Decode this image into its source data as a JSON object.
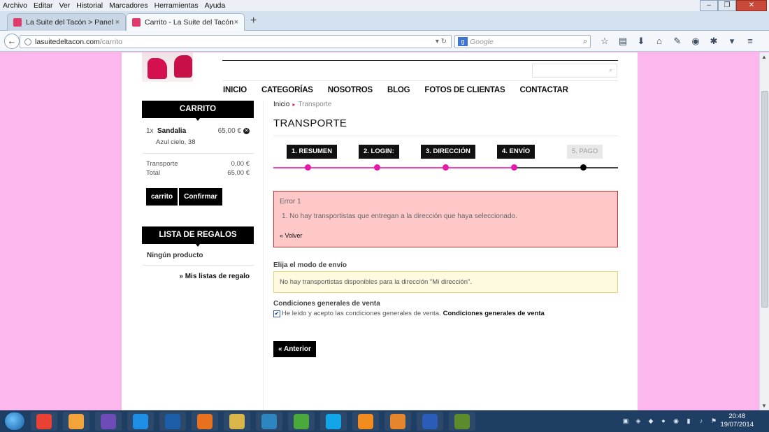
{
  "browser": {
    "menu": [
      "Archivo",
      "Editar",
      "Ver",
      "Historial",
      "Marcadores",
      "Herramientas",
      "Ayuda"
    ],
    "tabs": [
      {
        "label": "La Suite del Tacón > Panel ...",
        "active": false
      },
      {
        "label": "Carrito - La Suite del Tacón",
        "active": true
      }
    ],
    "new_tab": "+",
    "tab_close": "×",
    "url_host": "lasuitedeltacon.com",
    "url_path": "/carrito",
    "search_engine": "Google",
    "search_placeholder": "Google",
    "window_controls": {
      "minimize": "–",
      "restore": "❐",
      "close": "✕"
    }
  },
  "site": {
    "nav": [
      "INICIO",
      "CATEGORÍAS",
      "NOSOTROS",
      "BLOG",
      "FOTOS DE CLIENTAS",
      "CONTACTAR"
    ],
    "cart": {
      "title": "CARRITO",
      "item": {
        "qty": "1x",
        "name": "Sandalia",
        "price": "65,00 €",
        "variant": "Azul cielo, 38"
      },
      "shipping_label": "Transporte",
      "shipping_value": "0,00 €",
      "total_label": "Total",
      "total_value": "65,00 €",
      "btn_cart": "carrito",
      "btn_confirm": "Confirmar"
    },
    "gifts": {
      "title": "LISTA DE REGALOS",
      "empty": "Ningún producto",
      "link": "» Mis listas de regalo"
    },
    "breadcrumb": {
      "home": "Inicio",
      "current": "Transporte"
    },
    "page_title": "TRANSPORTE",
    "steps": [
      "1. RESUMEN",
      "2. LOGIN:",
      "3. DIRECCIÓN",
      "4. ENVÍO",
      "5. PAGO"
    ],
    "error": {
      "title": "Error 1",
      "message": "1.   No hay transportistas que entregan a la dirección que haya seleccionado.",
      "back": "« Volver"
    },
    "shipping_mode_label": "Elija el modo de envío",
    "shipping_warning": "No hay transportistas disponibles para la dirección \"Mi dirección\".",
    "conditions_label": "Condiciones generales de venta",
    "conditions_check_text": "He leído y acepto las condiciones generales de venta.",
    "conditions_link": "Condiciones generales de venta",
    "prev_button": "« Anterior"
  },
  "taskbar": {
    "time": "20:48",
    "date": "19/07/2014",
    "apps": [
      "chrome",
      "paint",
      "eclipse",
      "dropbox",
      "power",
      "firefox",
      "explorer",
      "filezilla",
      "utorrent",
      "skype",
      "media-player",
      "outlook",
      "word",
      "dreamweaver"
    ],
    "app_colors": [
      "#e94235",
      "#f2a33a",
      "#6f4bb8",
      "#1f8fe5",
      "#1c5fa8",
      "#e8711f",
      "#d9b54a",
      "#2e86c1",
      "#4aa83c",
      "#12a5e8",
      "#f28c1e",
      "#e6862c",
      "#2a5cb8",
      "#5b8b2a"
    ]
  }
}
